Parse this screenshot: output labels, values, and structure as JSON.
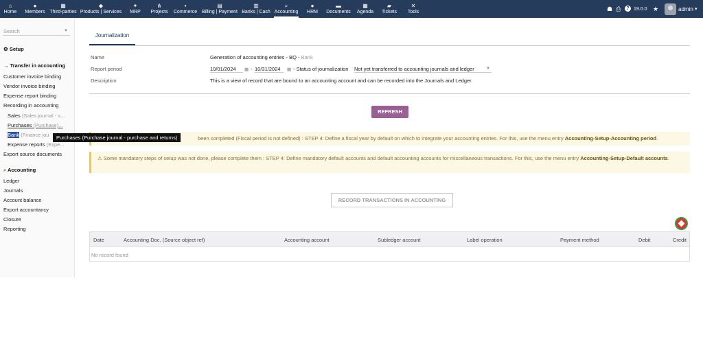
{
  "topbar": {
    "menus": [
      {
        "label": "Home",
        "icon": "home-icon",
        "glyph": "⌂"
      },
      {
        "label": "Members",
        "icon": "user-icon",
        "glyph": "●"
      },
      {
        "label": "Third-parties",
        "icon": "building-icon",
        "glyph": "▦"
      },
      {
        "label": "Products | Services",
        "icon": "cube-icon",
        "glyph": "◆"
      },
      {
        "label": "MRP",
        "icon": "cubes-icon",
        "glyph": "✦"
      },
      {
        "label": "Projects",
        "icon": "sitemap-icon",
        "glyph": "⋔"
      },
      {
        "label": "Commerce",
        "icon": "suitcase-icon",
        "glyph": "▪"
      },
      {
        "label": "Billing | Payment",
        "icon": "invoice-icon",
        "glyph": "▤"
      },
      {
        "label": "Banks | Cash",
        "icon": "bank-icon",
        "glyph": "▥"
      },
      {
        "label": "Accounting",
        "icon": "search-dollar-icon",
        "glyph": "⌕"
      },
      {
        "label": "HRM",
        "icon": "user-tie-icon",
        "glyph": "●"
      },
      {
        "label": "Documents",
        "icon": "folder-icon",
        "glyph": "▬"
      },
      {
        "label": "Agenda",
        "icon": "calendar-icon",
        "glyph": "▦"
      },
      {
        "label": "Tickets",
        "icon": "ticket-icon",
        "glyph": "▰"
      },
      {
        "label": "Tools",
        "icon": "tools-icon",
        "glyph": "✕"
      }
    ],
    "version": "19.0.0",
    "user": "admin",
    "icons": {
      "bug": "☗",
      "print": "⎙",
      "help": "?",
      "star": "★",
      "caret": "▾"
    }
  },
  "sidebar": {
    "search_placeholder": "Search",
    "setup": "Setup",
    "transfer_title": "Transfer in accounting",
    "customer_invoice_binding": "Customer invoice binding",
    "vendor_invoice_binding": "Vendor invoice binding",
    "expense_report_binding": "Expense report binding",
    "recording": "Recording in accounting",
    "sales": "Sales",
    "sales_sub": "(Sales journal - s...",
    "purchases": "Purchases",
    "purchases_sub": "(Purchase)...",
    "bank": "Bank",
    "bank_sub": "(Finance jou",
    "expense_reports": "Expense reports",
    "expense_sub": "(Expe...",
    "export_source": "Export source documents",
    "accounting_title": "Accounting",
    "ledger": "Ledger",
    "journals": "Journals",
    "account_balance": "Account balance",
    "export_accountancy": "Export accountancy",
    "closure": "Closure",
    "reporting": "Reporting"
  },
  "tooltip": "Purchases (Purchase journal - purchase and returns)",
  "main": {
    "tab": "Journalization",
    "name_label": "Name",
    "name_value": "Generation of accounting entries - BQ -",
    "name_suffix": "Bank",
    "period_label": "Report period",
    "date_from": "10/01/2024",
    "date_sep": "-",
    "date_to": "10/31/2024",
    "status_label": "- Status of journalization",
    "status_value": "Not yet transferred to accounting journals and ledger",
    "description_label": "Description",
    "description_value": "This is a view of record that are bound to an accounting account and can be recorded into the Journals and Ledger.",
    "refresh": "REFRESH",
    "warning1_text": "been completed (Fiscal period is not defined) : STEP 4: Define a fiscal year by default on which to integrate your accounting entries. For this, use the menu entry",
    "warning1_bold": "Accounting-Setup-Accounting period",
    "warning2_text": "Some mandatory steps of setup was not done, please complete them : STEP 4: Define mandatory default accounts and default accounting accounts for miscellaneous transactions. For this, use the menu entry",
    "warning2_bold": "Accounting-Setup-Default accounts",
    "record_button": "RECORD TRANSACTIONS IN ACCOUNTING",
    "table_headers": [
      "Date",
      "Accounting Doc. (Source object ref)",
      "Accounting account",
      "Subledger account",
      "Label operation",
      "Payment method",
      "Debit",
      "Credit"
    ],
    "no_record": "No record found"
  }
}
